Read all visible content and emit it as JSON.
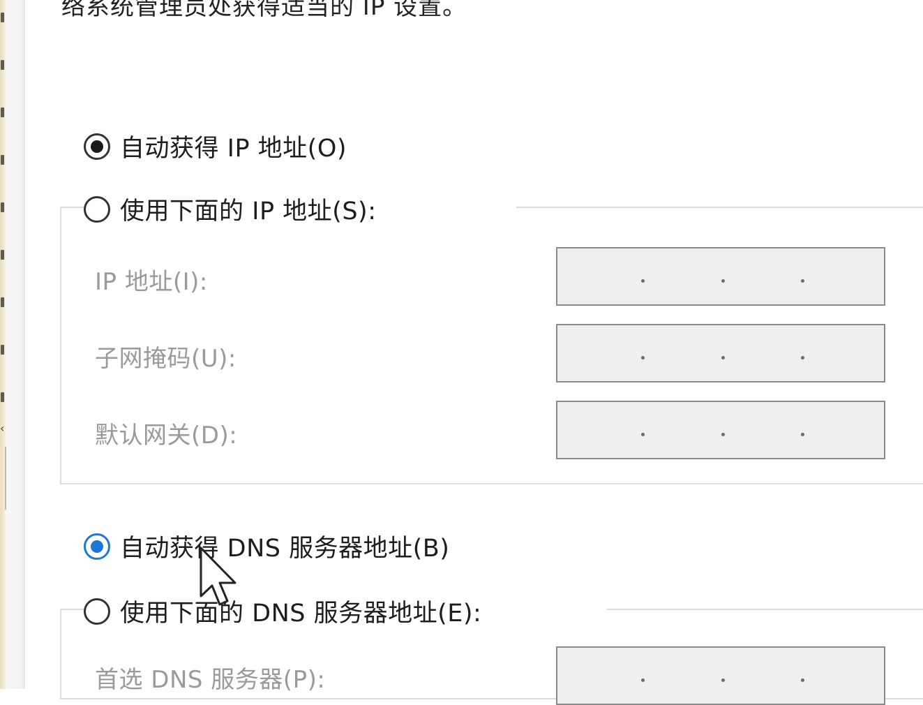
{
  "header": {
    "instruction_partial": "络系统管理员处获得适当的 IP 设置。"
  },
  "ip_section": {
    "auto_ip_label": "自动获得 IP 地址(O)",
    "auto_ip_checked": true,
    "manual_ip_label": "使用下面的 IP 地址(S):",
    "manual_ip_checked": false,
    "fields": [
      {
        "label": "IP 地址(I):",
        "value": "   .   .   ."
      },
      {
        "label": "子网掩码(U):",
        "value": "   .   .   ."
      },
      {
        "label": "默认网关(D):",
        "value": "   .   .   ."
      }
    ]
  },
  "dns_section": {
    "auto_dns_label": "自动获得 DNS 服务器地址(B)",
    "auto_dns_checked": true,
    "manual_dns_label": "使用下面的 DNS 服务器地址(E):",
    "manual_dns_checked": false,
    "fields": [
      {
        "label": "首选 DNS 服务器(P):",
        "value": "   .   .   ."
      }
    ]
  },
  "colors": {
    "accent": "#1e77d6",
    "disabled_text": "#9a9a9a",
    "field_bg": "#efefef"
  },
  "icons": {
    "cursor": "mouse-pointer-icon"
  }
}
